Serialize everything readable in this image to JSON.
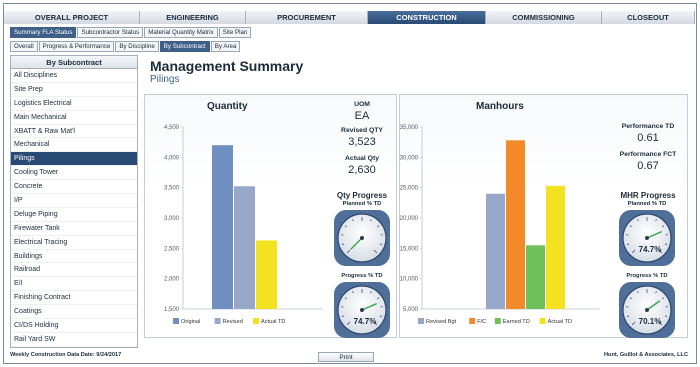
{
  "top_tabs": [
    {
      "label": "OVERALL PROJECT",
      "active": false
    },
    {
      "label": "ENGINEERING",
      "active": false
    },
    {
      "label": "PROCUREMENT",
      "active": false
    },
    {
      "label": "CONSTRUCTION",
      "active": true
    },
    {
      "label": "COMMISSIONING",
      "active": false
    },
    {
      "label": "CLOSEOUT",
      "active": false
    }
  ],
  "sub_tabs": [
    {
      "label": "Summary FLA Status",
      "active": true
    },
    {
      "label": "Subcontractor Status",
      "active": false
    },
    {
      "label": "Material Quantity Matrix",
      "active": false
    },
    {
      "label": "Site Plan",
      "active": false
    }
  ],
  "view_tabs": [
    {
      "label": "Overall",
      "active": false
    },
    {
      "label": "Progress & Performance",
      "active": false
    },
    {
      "label": "By Discipline",
      "active": false
    },
    {
      "label": "By Subcontract",
      "active": true
    },
    {
      "label": "By Area",
      "active": false
    }
  ],
  "sidebar": {
    "title": "By Subcontract",
    "selected": "Pilings",
    "items": [
      "All Disciplines",
      "Site Prep",
      "Logistics Electrical",
      "Main Mechanical",
      "XBATT & Raw Mat'l",
      "Mechanical",
      "Pilings",
      "Cooling Tower",
      "Concrete",
      "I/P",
      "Deluge Piping",
      "Firewater Tank",
      "Electrical Tracing",
      "Buildings",
      "Railroad",
      "E/I",
      "Finishing Contract",
      "Coatings",
      "CI/DS Holding",
      "Rail Yard SW"
    ]
  },
  "main": {
    "title": "Management Summary",
    "subtitle": "Pilings"
  },
  "quantity": {
    "title": "Quantity",
    "uom_label": "UOM",
    "uom_value": "EA",
    "revised_label": "Revised QTY",
    "revised_value": "3,523",
    "actual_label": "Actual Qty",
    "actual_value": "2,630",
    "progress_title": "Qty Progress",
    "planned_caption": "Planned % TD",
    "planned_pct": 0,
    "progress_caption": "Progress % TD",
    "progress_value": "74.7%",
    "progress_pct": 74.7
  },
  "manhours": {
    "title": "Manhours",
    "perf_td_label": "Performance TD",
    "perf_td_value": "0.61",
    "perf_fct_label": "Performance FCT",
    "perf_fct_value": "0.67",
    "mhr_title": "MHR Progress",
    "planned_caption": "Planned % TD",
    "planned_value": "74.7%",
    "planned_pct": 74.7,
    "progress_caption": "Progress % TD",
    "progress_value": "70.1%",
    "progress_pct": 70.1
  },
  "chart_data": [
    {
      "type": "bar",
      "title": "Quantity",
      "categories": [
        "Pilings"
      ],
      "series": [
        {
          "name": "Original",
          "values": [
            4200
          ],
          "color": "#6f8fc0"
        },
        {
          "name": "Revised",
          "values": [
            3523
          ],
          "color": "#98a8c8"
        },
        {
          "name": "Actual TD",
          "values": [
            2630
          ],
          "color": "#f2e21f"
        }
      ],
      "ylim": [
        1500,
        4500
      ],
      "yticks": [
        "1,500",
        "2,000",
        "2,500",
        "3,000",
        "3,500",
        "4,000",
        "4,500"
      ],
      "ytick_values": [
        1500,
        2000,
        2500,
        3000,
        3500,
        4000,
        4500
      ],
      "legend": "bottom"
    },
    {
      "type": "bar",
      "title": "Manhours",
      "categories": [
        "Pilings"
      ],
      "series": [
        {
          "name": "Revised Bgt",
          "values": [
            24000
          ],
          "color": "#98a8c8"
        },
        {
          "name": "F/C",
          "values": [
            32800
          ],
          "color": "#f28a2a"
        },
        {
          "name": "Earned TD",
          "values": [
            15500
          ],
          "color": "#6fbf5a"
        },
        {
          "name": "Actual TD",
          "values": [
            25300
          ],
          "color": "#f2e21f"
        }
      ],
      "ylim": [
        5000,
        35000
      ],
      "yticks": [
        "5,000",
        "10,000",
        "15,000",
        "20,000",
        "25,000",
        "30,000",
        "35,000"
      ],
      "ytick_values": [
        5000,
        10000,
        15000,
        20000,
        25000,
        30000,
        35000
      ],
      "legend": "bottom"
    }
  ],
  "footer": {
    "data_date": "Weekly Construction Data Date:  9/24/2017",
    "print_label": "Print",
    "company": "Hunt, Guillot & Associates, LLC"
  }
}
